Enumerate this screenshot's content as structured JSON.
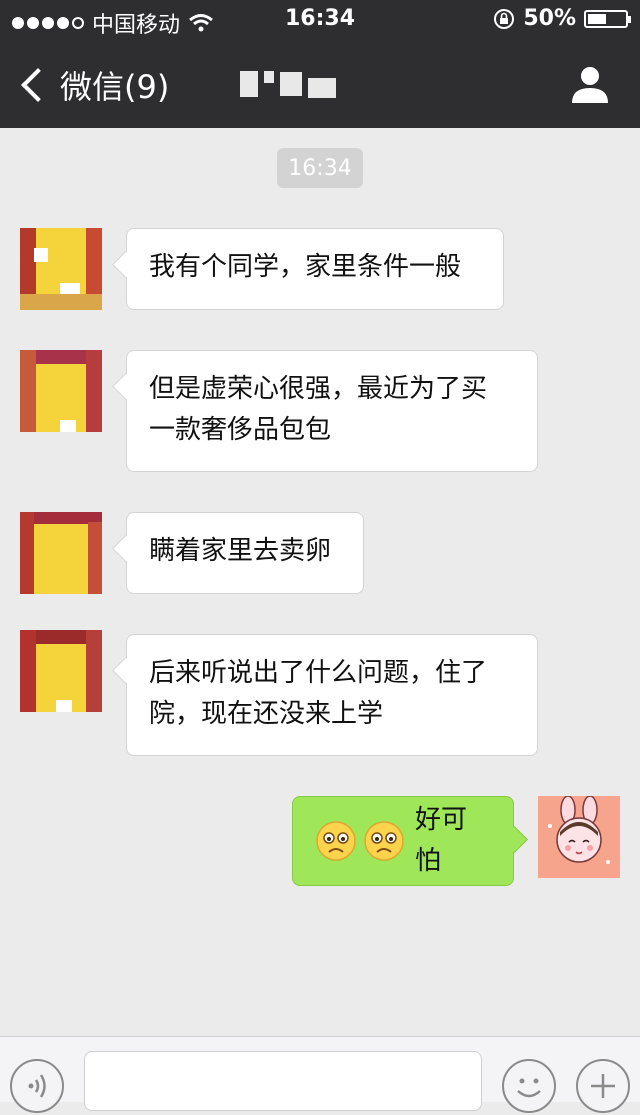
{
  "status_bar": {
    "carrier": "中国移动",
    "time": "16:34",
    "battery": "50%"
  },
  "nav": {
    "back_label": "微信(9)"
  },
  "chat": {
    "timestamp": "16:34",
    "messages": [
      {
        "text": "我有个同学，家里条件一般"
      },
      {
        "line1": "但是虚荣心很强，最近为了买",
        "line2": "一款奢侈品包包"
      },
      {
        "text": "瞒着家里去卖卵"
      },
      {
        "line1": "后来听说出了什么问题，住了",
        "line2": "院，现在还没来上学"
      },
      {
        "text": "好可怕",
        "emojis": [
          "worried-face-icon",
          "worried-face-icon"
        ]
      }
    ]
  },
  "colors": {
    "header_bg": "#2e2e30",
    "chat_bg": "#ebebeb",
    "outgoing_bubble": "#9fe658",
    "incoming_bubble": "#ffffff"
  }
}
